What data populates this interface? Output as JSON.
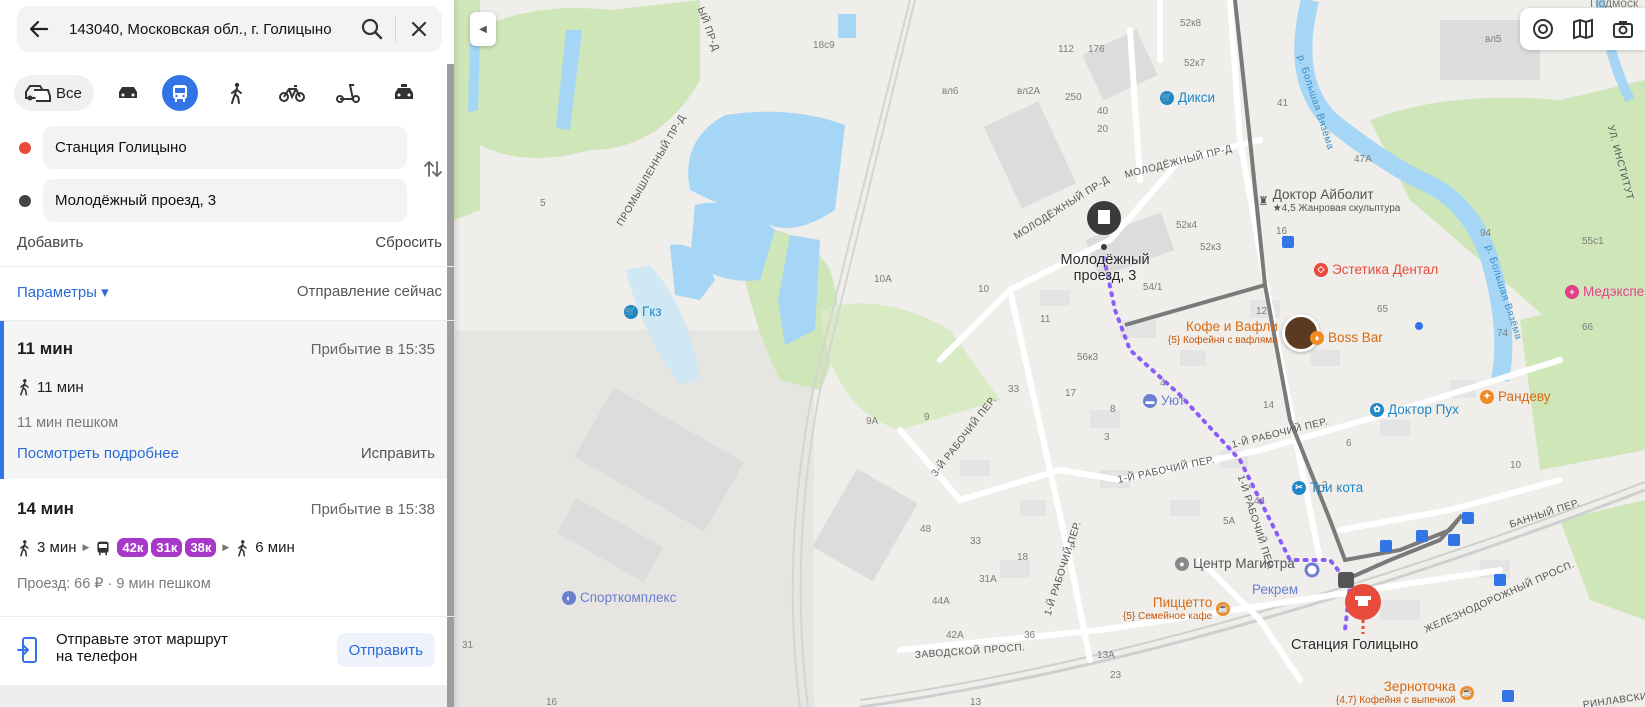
{
  "search": {
    "query": "143040, Московская обл., г. Голицыно"
  },
  "modes": {
    "all_label": "Все",
    "active": "bus"
  },
  "points": {
    "from": "Станция Голицыно",
    "to": "Молодёжный проезд, 3"
  },
  "actions": {
    "add": "Добавить",
    "reset": "Сбросить"
  },
  "params": {
    "label": "Параметры ▾",
    "departure": "Отправление сейчас"
  },
  "routes": [
    {
      "duration": "11 мин",
      "arrival": "Прибытие в 15:35",
      "walk": "11 мин",
      "summary": "11 мин пешком",
      "details": "Посмотреть подробнее",
      "fix": "Исправить"
    },
    {
      "duration": "14 мин",
      "arrival": "Прибытие в 15:38",
      "walk_start": "3 мин",
      "buses": [
        "42к",
        "31к",
        "38к"
      ],
      "walk_end": "6 мин",
      "summary": "Проезд: 66 ₽ · 9 мин пешком"
    }
  ],
  "send": {
    "text_line1": "Отправьте этот маршрут",
    "text_line2": "на телефон",
    "button": "Отправить"
  },
  "map": {
    "pois": {
      "dixy": "Дикси",
      "gkz": "Гкз",
      "aibolit": "Доктор Айболит",
      "aibolit_sub": "★4,5 Жанровая скульптура",
      "estetika": "Эстетика Дентал",
      "kofe": "Кофе и Вафли",
      "kofe_sub": "{5} Кофейня с вафлями",
      "bossbar": "Boss Bar",
      "medexp": "Медэкспе",
      "randevu": "Рандеву",
      "doktorpuh": "Доктор Пух",
      "uyut": "Уют",
      "trikota": "Три кота",
      "centr": "Центр Магистра",
      "rekrem": "Рекрем",
      "pizzetto": "Пиццетто",
      "pizzetto_sub": "{5} Семейное кафе",
      "sport": "Спорткомплекс",
      "zernotochka": "Зерноточка",
      "zernotochka_sub": "{4,7} Кофейня с выпечкой",
      "podmosk": "Подмоск"
    },
    "destination_label_1": "Молодёжный",
    "destination_label_2": "проезд, 3",
    "station_label": "Станция Голицыно",
    "streets": {
      "promysh": "ПРОМЫШЛЕННЫЙ ПР-Д",
      "molod1": "МОЛОДЁЖНЫЙ ПР-Д",
      "molod2": "МОЛОДЁЖНЫЙ ПР-Д",
      "rab1": "1-Й РАБОЧИЙ ПЕР.",
      "rab1b": "1-Й РАБОЧИЙ ПЕР.",
      "rab1c": "1-Й РАБОЧИЙ ПЕР.",
      "rab1d": "1-Й РАБОЧИЙ ПЕР.",
      "rab3": "3-Й РАБОЧИЙ ПЕР.",
      "zavod": "ЗАВОДСКОЙ ПРОСП.",
      "zheldor": "ЖЕЛЕЗНОДОРОЖНЫЙ ПРОСП.",
      "bannyi": "БАННЫЙ ПЕР.",
      "vyazema1": "р. Большая Вязёма",
      "vyazema2": "р. Большая Вязёма",
      "institut": "УЛ. ИНСТИТУТ",
      "sunday": "ЫЙ ПР-Д",
      "rinlav": "РИНЛАВСКИЙ"
    },
    "houses": [
      "18с9",
      "52к8",
      "вл5",
      "112",
      "176",
      "52к7",
      "вл6",
      "вл2А",
      "250",
      "41",
      "40",
      "20",
      "47А",
      "5",
      "52к4",
      "52к3",
      "16",
      "94",
      "55с1",
      "10А",
      "10",
      "54/1",
      "11",
      "65",
      "12",
      "56к3",
      "17",
      "74",
      "66",
      "33",
      "8",
      "9А",
      "9",
      "3",
      "4",
      "5А",
      "44",
      "14",
      "6",
      "10",
      "2",
      "48",
      "4",
      "18",
      "33",
      "31А",
      "44А",
      "36",
      "42А",
      "13А",
      "23",
      "16",
      "31",
      "13"
    ],
    "colors": {
      "walk_route": "#8b5cf6",
      "transit_route": "#6a6a6a",
      "road": "#ffffff",
      "water": "#a5d6f5",
      "park": "#cfe6b9"
    }
  }
}
